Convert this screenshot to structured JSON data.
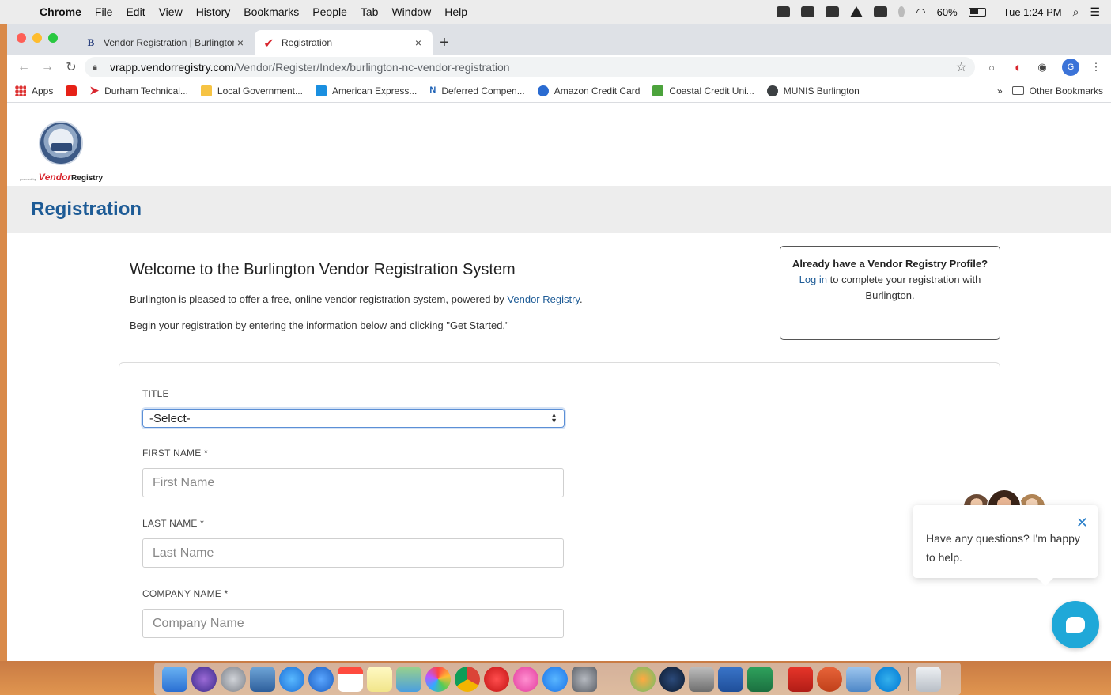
{
  "menubar": {
    "app": "Chrome",
    "items": [
      "File",
      "Edit",
      "View",
      "History",
      "Bookmarks",
      "People",
      "Tab",
      "Window",
      "Help"
    ],
    "battery": "60%",
    "clock": "Tue 1:24 PM"
  },
  "tabs": [
    {
      "favicon": "B",
      "title": "Vendor Registration | Burlington"
    },
    {
      "favicon": "✔",
      "title": "Registration"
    }
  ],
  "toolbar": {
    "url_host": "vrapp.vendorregistry.com",
    "url_path": "/Vendor/Register/Index/burlington-nc-vendor-registration",
    "profile_initial": "G"
  },
  "bookmarks": {
    "items": [
      "Apps",
      "Durham Technical...",
      "Local Government...",
      "American Express...",
      "Deferred Compen...",
      "Amazon Credit Card",
      "Coastal Credit Uni...",
      "MUNIS Burlington"
    ],
    "overflow": "»",
    "other": "Other Bookmarks"
  },
  "logo": {
    "powered_by": "powered by",
    "brand_v": "V",
    "brand_rest": "endor",
    "brand_registry": "Registry"
  },
  "page": {
    "heading": "Registration",
    "welcome_title": "Welcome to the Burlington Vendor Registration System",
    "intro_prefix": "Burlington is pleased to offer a free, online vendor registration system, powered by ",
    "intro_link": "Vendor Registry",
    "intro_suffix": ".",
    "instructions": "Begin your registration by entering the information below and clicking \"Get Started.\""
  },
  "already": {
    "title": "Already have a Vendor Registry Profile?",
    "login_link": "Log in",
    "text": " to complete your registration with Burlington."
  },
  "form": {
    "title_label": "TITLE",
    "title_value": "-Select-",
    "first_name_label": "FIRST NAME *",
    "first_name_placeholder": "First Name",
    "last_name_label": "LAST NAME *",
    "last_name_placeholder": "Last Name",
    "company_label": "COMPANY NAME *",
    "company_placeholder": "Company Name"
  },
  "chat": {
    "message": "Have any questions? I'm happy to help."
  },
  "colors": {
    "heading_blue": "#1d5b96",
    "chat_button": "#1fa8d8",
    "brand_red": "#d8262e"
  }
}
